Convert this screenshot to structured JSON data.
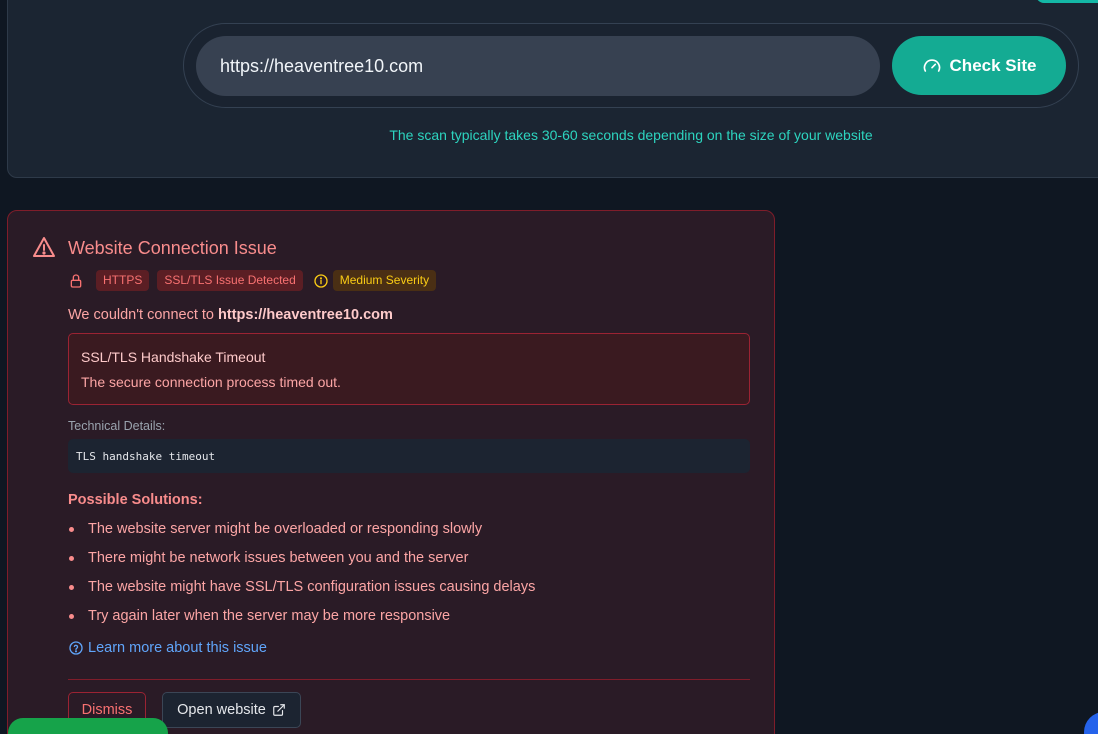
{
  "scan": {
    "url_value": "https://heaventree10.com",
    "check_label": "Check Site",
    "hint": "The scan typically takes 30-60 seconds depending on the size of your website"
  },
  "error": {
    "title": "Website Connection Issue",
    "badges": {
      "https": "HTTPS",
      "ssl": "SSL/TLS Issue Detected",
      "severity": "Medium Severity"
    },
    "message_prefix": "We couldn't connect to ",
    "message_url": "https://heaventree10.com",
    "box_title": "SSL/TLS Handshake Timeout",
    "box_desc": "The secure connection process timed out.",
    "tech_label": "Technical Details:",
    "tech_value": "TLS handshake timeout",
    "solutions_title": "Possible Solutions:",
    "solutions": [
      "The website server might be overloaded or responding slowly",
      "There might be network issues between you and the server",
      "The website might have SSL/TLS configuration issues causing delays",
      "Try again later when the server may be more responsive"
    ],
    "learn_more": "Learn more about this issue",
    "dismiss_label": "Dismiss",
    "open_label": "Open website"
  },
  "colors": {
    "accent": "#14ab93",
    "danger": "#f87171",
    "warning": "#facc15",
    "link": "#60a5fa"
  },
  "icons": {
    "check": "gauge-icon",
    "warning": "warning-triangle-icon",
    "lock": "lock-icon",
    "info": "info-circle-icon",
    "help": "help-circle-icon",
    "external": "external-link-icon"
  }
}
